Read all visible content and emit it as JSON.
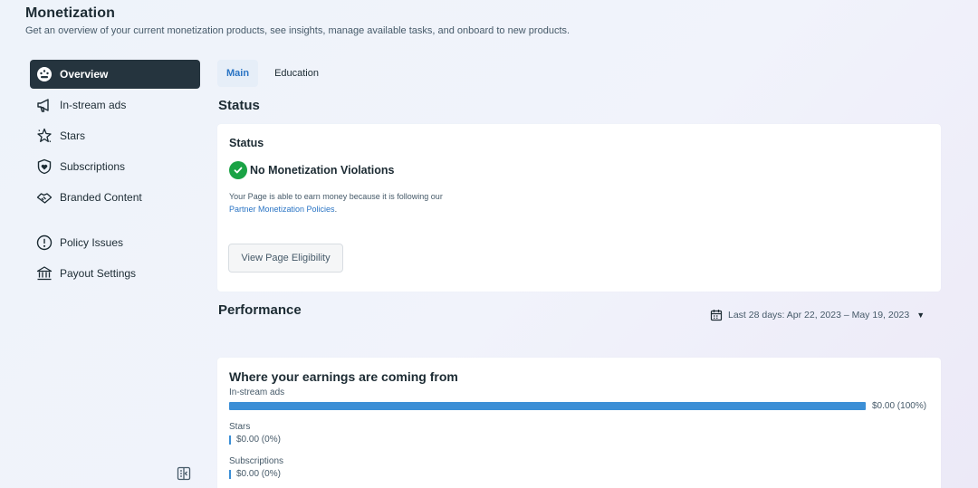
{
  "header": {
    "title": "Monetization",
    "subtitle": "Get an overview of your current monetization products, see insights, manage available tasks, and onboard to new products."
  },
  "sidebar": {
    "items": [
      {
        "label": "Overview",
        "icon": "dashboard-icon",
        "active": true
      },
      {
        "label": "In-stream ads",
        "icon": "megaphone-icon"
      },
      {
        "label": "Stars",
        "icon": "stars-icon"
      },
      {
        "label": "Subscriptions",
        "icon": "heart-shield-icon"
      },
      {
        "label": "Branded Content",
        "icon": "handshake-icon"
      },
      {
        "label": "Policy Issues",
        "icon": "alert-circle-icon"
      },
      {
        "label": "Payout Settings",
        "icon": "bank-icon"
      }
    ]
  },
  "tabs": [
    {
      "label": "Main",
      "active": true
    },
    {
      "label": "Education"
    }
  ],
  "status": {
    "section_title": "Status",
    "card_title": "Status",
    "violation_text": "No Monetization Violations",
    "description": "Your Page is able to earn money because it is following our",
    "link_text": "Partner Monetization Policies",
    "link_suffix": ".",
    "button_label": "View Page Eligibility"
  },
  "performance": {
    "section_title": "Performance",
    "date_range": "Last 28 days: Apr 22, 2023 – May 19, 2023"
  },
  "earnings": {
    "title": "Where your earnings are coming from",
    "items": [
      {
        "label": "In-stream ads",
        "value": "$0.00 (100%)",
        "fraction": 1.0
      },
      {
        "label": "Stars",
        "value": "$0.00 (0%)",
        "fraction": 0
      },
      {
        "label": "Subscriptions",
        "value": "$0.00 (0%)",
        "fraction": 0
      }
    ]
  },
  "colors": {
    "accent": "#2a74c4",
    "bar": "#3c8fd6",
    "success": "#1aa345",
    "active_nav": "#25343e"
  }
}
